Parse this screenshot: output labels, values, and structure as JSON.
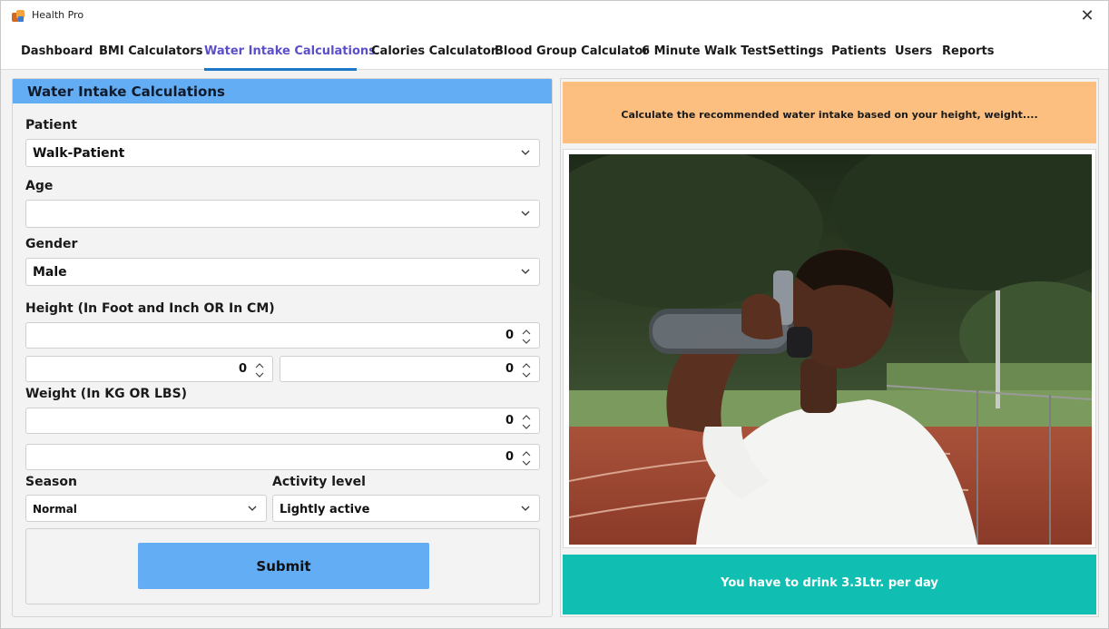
{
  "window": {
    "title": "Health Pro",
    "close_glyph": "✕"
  },
  "tabs": [
    {
      "label": "Dashboard"
    },
    {
      "label": "BMI Calculators"
    },
    {
      "label": "Water Intake Calculations"
    },
    {
      "label": "Calories Calculator"
    },
    {
      "label": "Blood Group Calculator"
    },
    {
      "label": "6 Minute Walk Test"
    },
    {
      "label": "Settings"
    },
    {
      "label": "Patients"
    },
    {
      "label": "Users"
    },
    {
      "label": "Reports"
    }
  ],
  "active_tab": "Water Intake Calculations",
  "form": {
    "header": "Water Intake Calculations",
    "patient": {
      "label": "Patient",
      "value": "Walk-Patient"
    },
    "age": {
      "label": "Age",
      "value": ""
    },
    "gender": {
      "label": "Gender",
      "value": "Male"
    },
    "height": {
      "label": "Height (In Foot and Inch OR In CM)",
      "cm_value": "0",
      "foot_value": "0",
      "inch_value": "0"
    },
    "weight": {
      "label": "Weight (In KG OR LBS)",
      "kg_value": "0",
      "lbs_value": "0"
    },
    "season": {
      "label": "Season",
      "value": "Normal"
    },
    "activity": {
      "label": "Activity level",
      "value": "Lightly active"
    },
    "submit_label": "Submit"
  },
  "info": {
    "text": "Calculate the recommended water intake based on your height, weight...."
  },
  "result": {
    "text": "You have to drink 3.3Ltr. per day"
  },
  "colors": {
    "accent_blue": "#63adf5",
    "active_tab": "#5b4fc9",
    "info_bg": "#fdbf80",
    "result_bg": "#10bfb2"
  },
  "icons": {
    "dropdown": "chevron-down-icon",
    "spinner": "up-down-spinner-icon",
    "close": "close-icon",
    "app": "app-logo-icon"
  }
}
